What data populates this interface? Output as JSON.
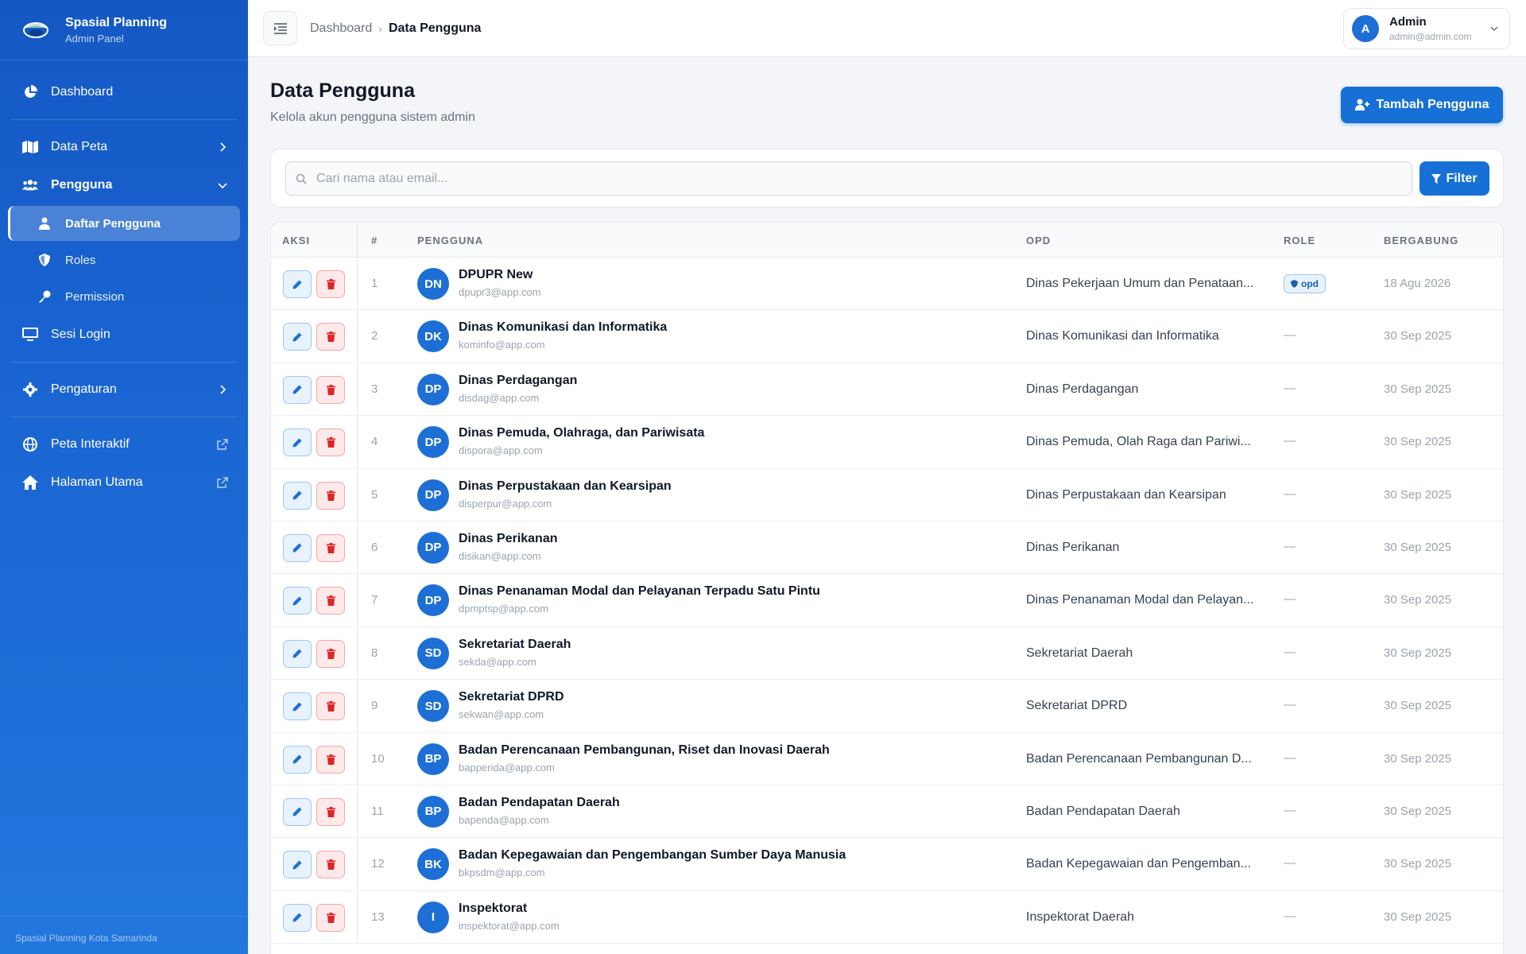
{
  "brand": {
    "title": "Spasial Planning",
    "subtitle": "Admin Panel"
  },
  "sidebar": {
    "dashboard": "Dashboard",
    "data_peta": "Data Peta",
    "pengguna": "Pengguna",
    "sub": {
      "daftar": "Daftar Pengguna",
      "roles": "Roles",
      "permission": "Permission"
    },
    "sesi_login": "Sesi Login",
    "pengaturan": "Pengaturan",
    "peta_interaktif": "Peta Interaktif",
    "halaman_utama": "Halaman Utama",
    "footer": "Spasial Planning Kota Samarinda"
  },
  "topbar": {
    "breadcrumb": [
      "Dashboard",
      "Data Pengguna"
    ],
    "user": {
      "initial": "A",
      "name": "Admin",
      "email": "admin@admin.com"
    }
  },
  "page": {
    "title": "Data Pengguna",
    "subtitle": "Kelola akun pengguna sistem admin",
    "add_button": "Tambah Pengguna",
    "search_placeholder": "Cari nama atau email...",
    "filter_button": "Filter"
  },
  "table": {
    "headers": {
      "aksi": "AKSI",
      "num": "#",
      "pengguna": "PENGGUNA",
      "opd": "OPD",
      "role": "ROLE",
      "bergabung": "BERGABUNG"
    },
    "rows": [
      {
        "num": "1",
        "initials": "DN",
        "name": "DPUPR New",
        "email": "dpupr3@app.com",
        "opd": "Dinas Pekerjaan Umum dan Penataan...",
        "role": "opd",
        "date": "18 Agu 2026"
      },
      {
        "num": "2",
        "initials": "DK",
        "name": "Dinas Komunikasi dan Informatika",
        "email": "kominfo@app.com",
        "opd": "Dinas Komunikasi dan Informatika",
        "role": "—",
        "date": "30 Sep 2025"
      },
      {
        "num": "3",
        "initials": "DP",
        "name": "Dinas Perdagangan",
        "email": "disdag@app.com",
        "opd": "Dinas Perdagangan",
        "role": "—",
        "date": "30 Sep 2025"
      },
      {
        "num": "4",
        "initials": "DP",
        "name": "Dinas Pemuda, Olahraga, dan Pariwisata",
        "email": "dispora@app.com",
        "opd": "Dinas Pemuda, Olah Raga dan Pariwi...",
        "role": "—",
        "date": "30 Sep 2025"
      },
      {
        "num": "5",
        "initials": "DP",
        "name": "Dinas Perpustakaan dan Kearsipan",
        "email": "disperpur@app.com",
        "opd": "Dinas Perpustakaan dan Kearsipan",
        "role": "—",
        "date": "30 Sep 2025"
      },
      {
        "num": "6",
        "initials": "DP",
        "name": "Dinas Perikanan",
        "email": "disikan@app.com",
        "opd": "Dinas Perikanan",
        "role": "—",
        "date": "30 Sep 2025"
      },
      {
        "num": "7",
        "initials": "DP",
        "name": "Dinas Penanaman Modal dan Pelayanan Terpadu Satu Pintu",
        "email": "dpmptsp@app.com",
        "opd": "Dinas Penanaman Modal dan Pelayan...",
        "role": "—",
        "date": "30 Sep 2025"
      },
      {
        "num": "8",
        "initials": "SD",
        "name": "Sekretariat Daerah",
        "email": "sekda@app.com",
        "opd": "Sekretariat Daerah",
        "role": "—",
        "date": "30 Sep 2025"
      },
      {
        "num": "9",
        "initials": "SD",
        "name": "Sekretariat DPRD",
        "email": "sekwan@app.com",
        "opd": "Sekretariat DPRD",
        "role": "—",
        "date": "30 Sep 2025"
      },
      {
        "num": "10",
        "initials": "BP",
        "name": "Badan Perencanaan Pembangunan, Riset dan Inovasi Daerah",
        "email": "bapperida@app.com",
        "opd": "Badan Perencanaan Pembangunan D...",
        "role": "—",
        "date": "30 Sep 2025"
      },
      {
        "num": "11",
        "initials": "BP",
        "name": "Badan Pendapatan Daerah",
        "email": "bapenda@app.com",
        "opd": "Badan Pendapatan Daerah",
        "role": "—",
        "date": "30 Sep 2025"
      },
      {
        "num": "12",
        "initials": "BK",
        "name": "Badan Kepegawaian dan Pengembangan Sumber Daya Manusia",
        "email": "bkpsdm@app.com",
        "opd": "Badan Kepegawaian dan Pengemban...",
        "role": "—",
        "date": "30 Sep 2025"
      },
      {
        "num": "13",
        "initials": "I",
        "name": "Inspektorat",
        "email": "inspektorat@app.com",
        "opd": "Inspektorat Daerah",
        "role": "—",
        "date": "30 Sep 2025"
      }
    ]
  },
  "colors": {
    "primary": "#1670d6",
    "sidebar_top": "#1558c4",
    "danger": "#dc2626"
  }
}
